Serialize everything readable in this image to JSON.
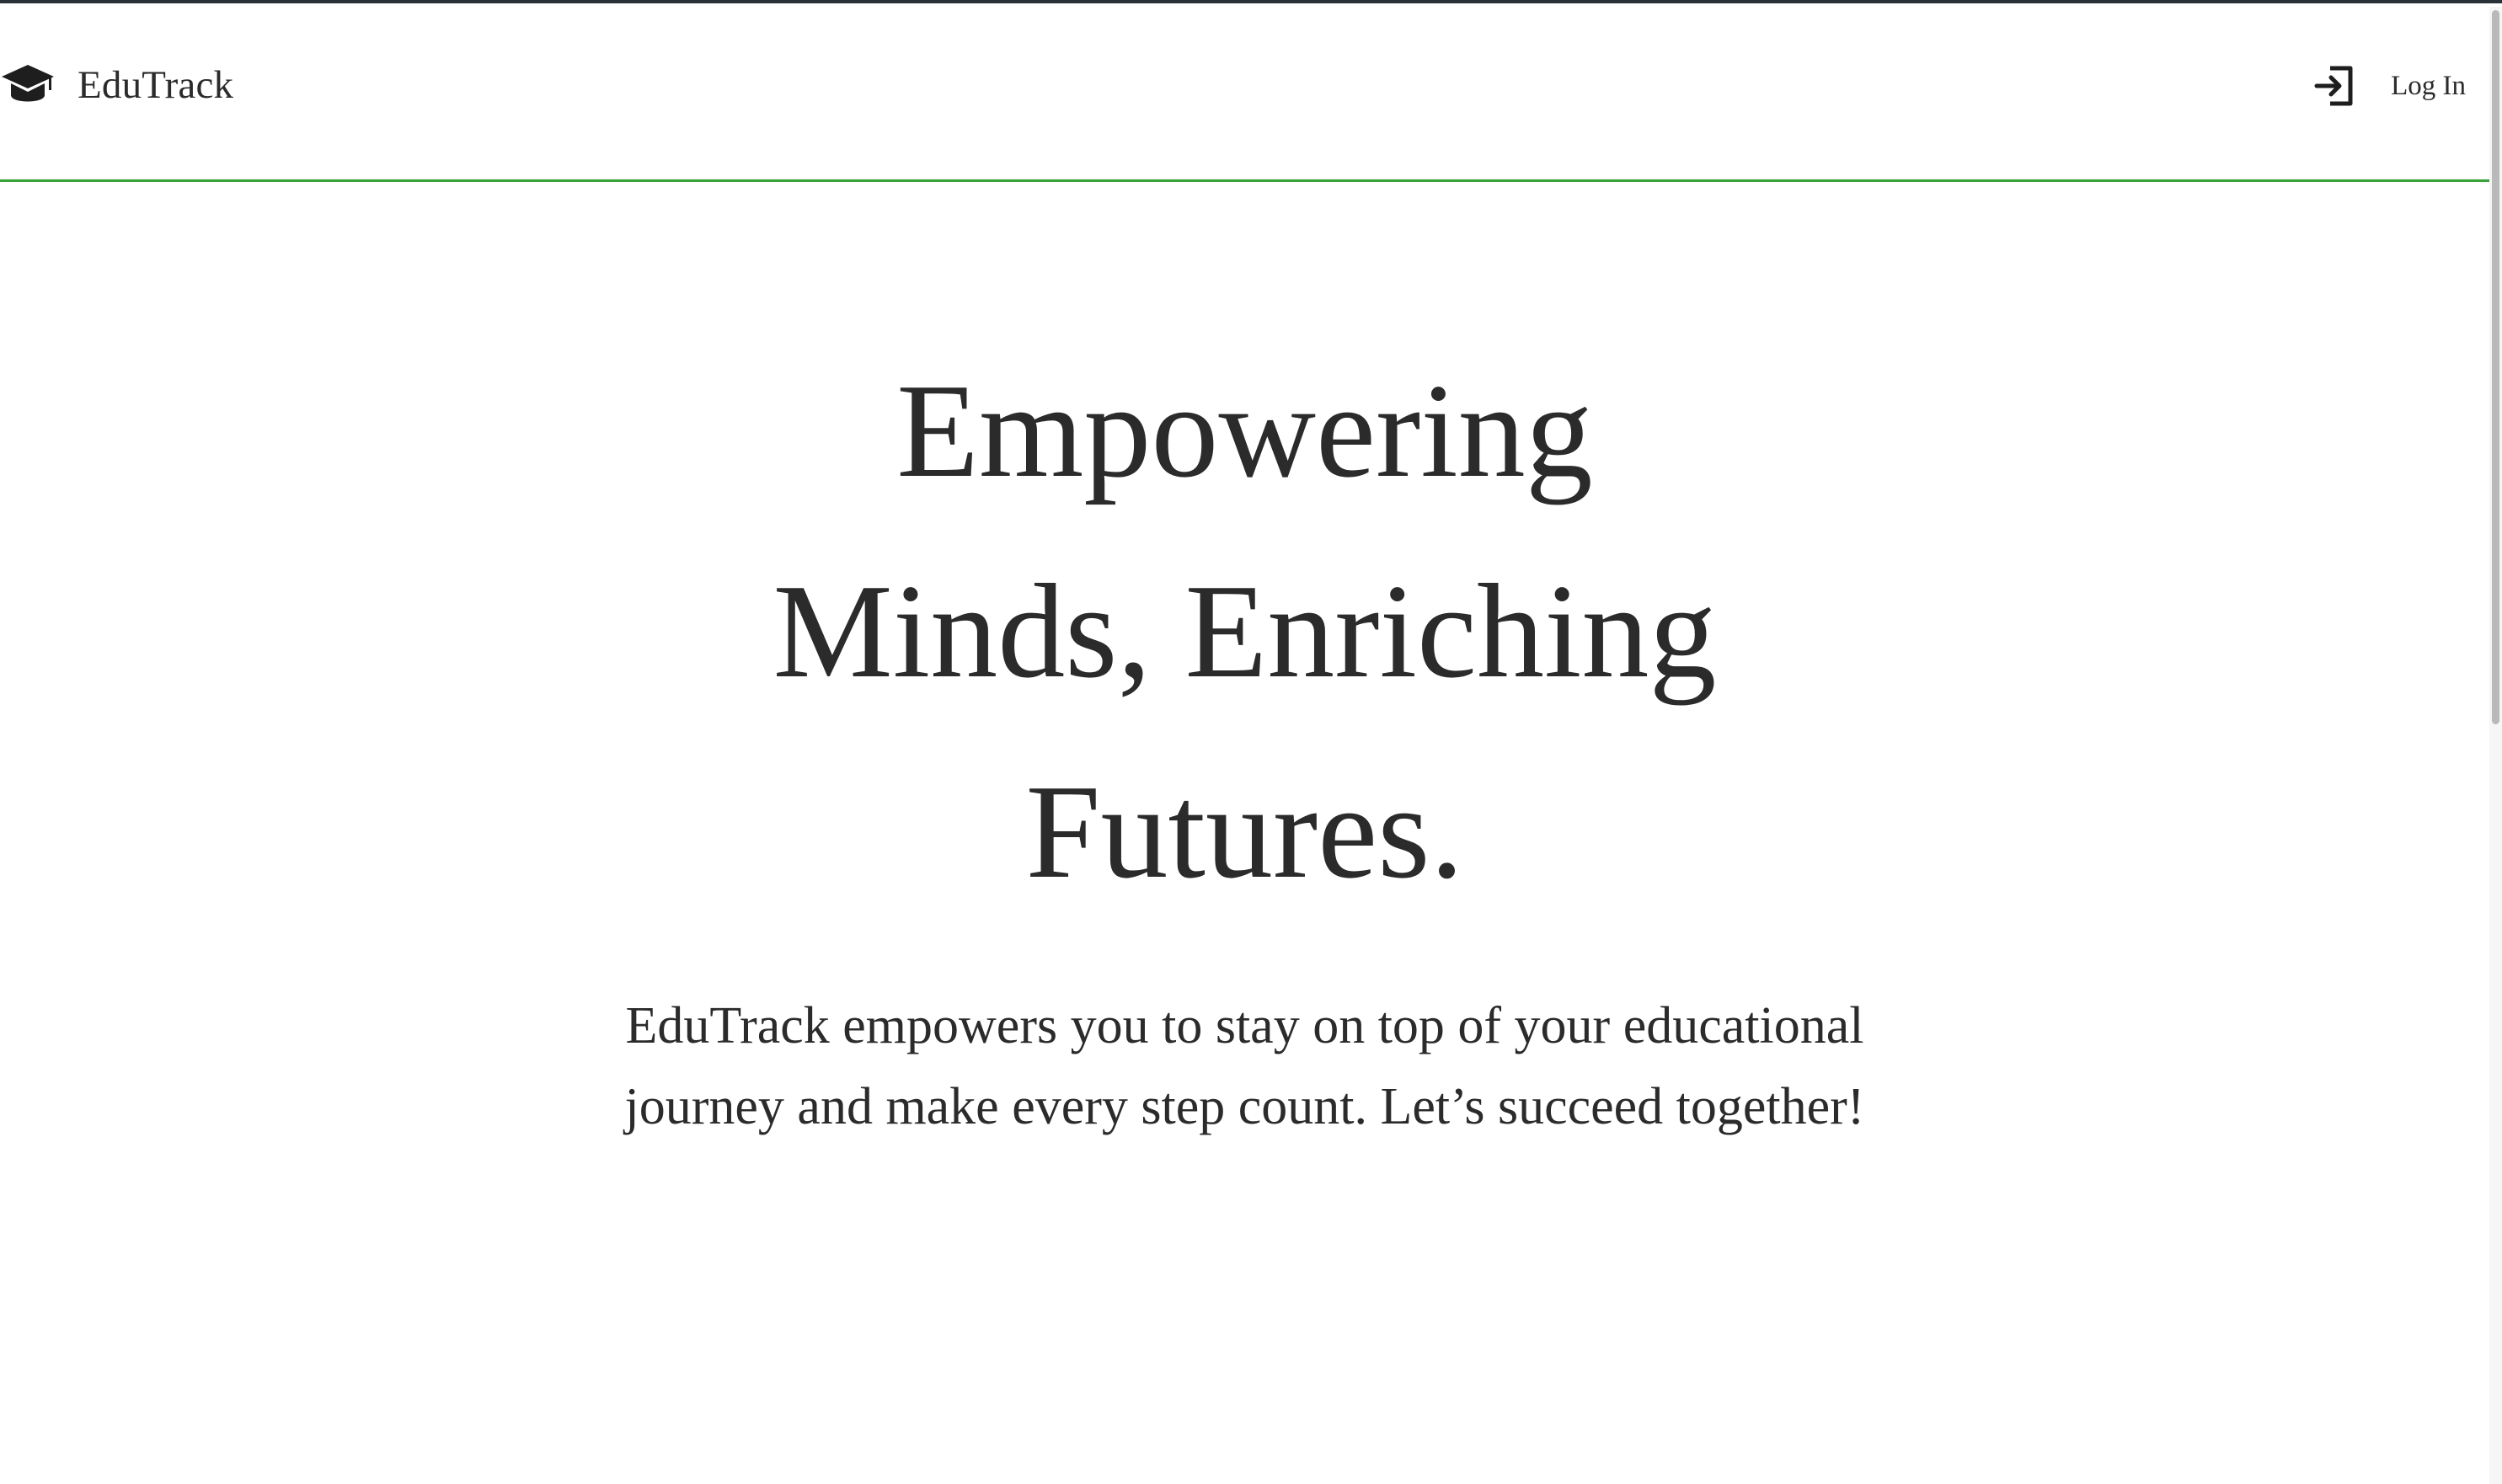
{
  "header": {
    "brand_name": "EduTrack",
    "brand_icon": "graduation-cap-icon",
    "login_label": "Log In",
    "login_icon": "sign-in-icon",
    "accent_color": "#3aa33a"
  },
  "hero": {
    "title": "Empowering Minds, Enriching Futures.",
    "description": "EduTrack empowers you to stay on top of your educational journey and make every step count. Let’s succeed together!"
  }
}
